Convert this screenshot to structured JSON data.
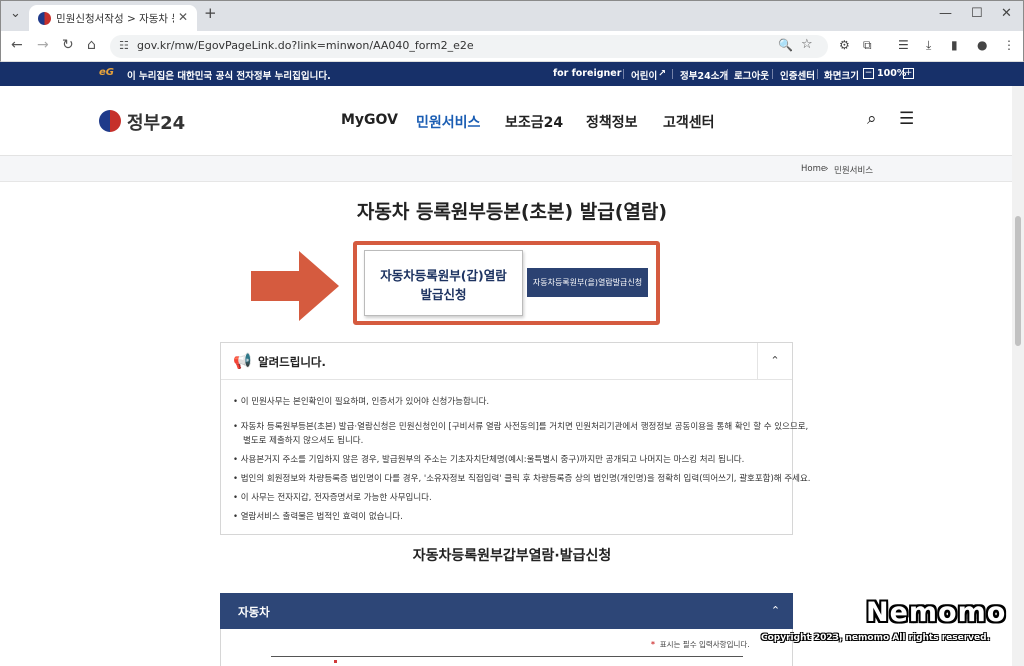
{
  "browser": {
    "tab_title": "민원신청서작성 > 자동차 등록",
    "url": "gov.kr/mw/EgovPageLink.do?link=minwon/AA040_form2_e2e",
    "new_tab": "+"
  },
  "gov_strip": {
    "eg": "eG",
    "notice": "이 누리집은 대한민국 공식 전자정부 누리집입니다.",
    "links": [
      "for foreigner",
      "어린이",
      "정부24소개",
      "로그아웃",
      "인증센터",
      "화면크기"
    ],
    "zoom": "100%"
  },
  "header": {
    "logo": "정부24",
    "menu": [
      "MyGOV",
      "민원서비스",
      "보조금24",
      "정책정보",
      "고객센터"
    ],
    "active_menu": "민원서비스"
  },
  "breadcrumb": {
    "home": "Home",
    "current": "민원서비스"
  },
  "page": {
    "title": "자동차 등록원부등본(초본) 발급(열람)",
    "btn_gap": "자동차등록원부(갑)열람발급신청",
    "btn_eul": "자동차등록원부(을)열람발급신청"
  },
  "notice": {
    "title": "알려드립니다.",
    "items": [
      "이 민원사무는 본인확인이 필요하며, 인증서가 있어야 신청가능합니다.",
      "자동차 등록원부등본(초본) 발급·열람신청은 민원신청인이 [구비서류 열람 사전동의]를 거치면 민원처리기관에서 행정정보 공동이용을 통해 확인 할 수 있으므로,",
      "별도로 제출하지 않으셔도 됩니다.",
      "사용본거지 주소를 기입하지 않은 경우, 발급원부의 주소는 기초자치단체명(예시:울특별시 중구)까지만 공개되고 나머지는 마스킹 처리 됩니다.",
      "법인의 회원정보와 차량등록증 법인명이 다를 경우, '소유자정보 직접입력' 클릭 후 차량등록증 상의 법인명(개인명)을 정확히 입력(띄어쓰기, 괄호포함)해 주세요.",
      "이 사무는 전자지갑, 전자증명서로 가능한 사무입니다.",
      "열람서비스 출력물은 법적인 효력이 없습니다."
    ]
  },
  "section": {
    "heading": "자동차등록원부갑부열람·발급신청",
    "car_title": "자동차",
    "required_note": "표시는 필수 입력사항입니다."
  },
  "watermark": {
    "name": "Nemomo",
    "copyright": "Copyright 2023, nemomo All rights reserved."
  }
}
